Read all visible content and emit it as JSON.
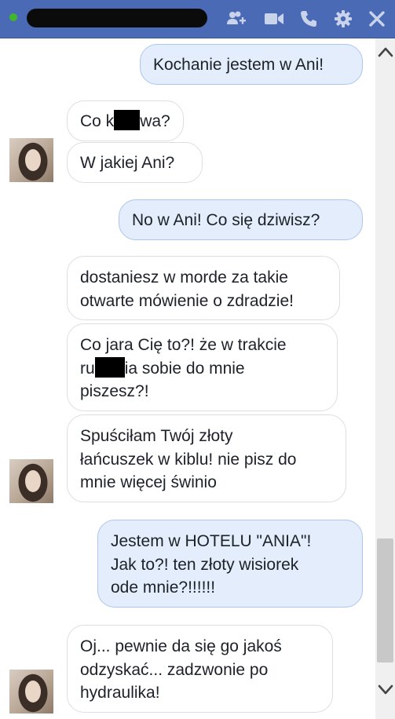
{
  "header": {
    "contact_name": "",
    "online": true,
    "icons": [
      "add-user-icon",
      "video-camera-icon",
      "phone-icon",
      "gear-icon",
      "close-icon"
    ]
  },
  "messages": [
    {
      "from": "me",
      "lines": [
        "Kochanie jestem w Ani!"
      ]
    },
    {
      "from": "them",
      "parts": [
        "Co k",
        "[redacted]",
        "wa?"
      ]
    },
    {
      "from": "them",
      "lines": [
        "W jakiej Ani?"
      ]
    },
    {
      "from": "me",
      "lines": [
        "No w Ani! Co się dziwisz?"
      ]
    },
    {
      "from": "them",
      "lines": [
        "dostaniesz w morde za takie",
        "otwarte mówienie o zdradzie!"
      ]
    },
    {
      "from": "them",
      "line1": "Co jara Cię to?! że w trakcie",
      "line2_parts": [
        "ru",
        "[redacted]",
        "ia sobie do mnie"
      ],
      "line3": "piszesz?!"
    },
    {
      "from": "them",
      "lines": [
        "Spuściłam Twój złoty",
        "łańcuszek w kiblu! nie pisz do",
        "mnie więcej świnio"
      ]
    },
    {
      "from": "me",
      "lines": [
        "Jestem w HOTELU \"ANIA\"!",
        "Jak to?! ten złoty wisiorek",
        "ode mnie?!!!!!!"
      ]
    },
    {
      "from": "them",
      "lines": [
        "Oj... pewnie da się go jakoś",
        "odzyskać... zadzwonie po",
        "hydraulika!"
      ]
    }
  ],
  "colors": {
    "header_bg": "#4a6ab5",
    "sent_bubble": "#e3edfb",
    "sent_border": "#aec6ee",
    "recv_border": "#dcdee2",
    "online": "#42b72a"
  }
}
